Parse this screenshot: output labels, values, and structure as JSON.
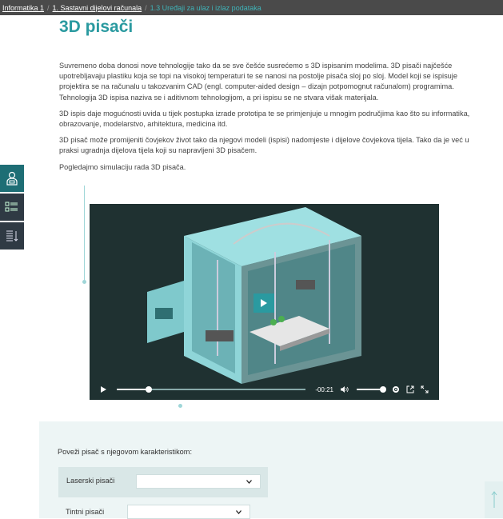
{
  "breadcrumb": {
    "items": [
      "Informatika 1",
      "1. Sastavni dijelovi računala",
      "1.3 Uređaji za ulaz i izlaz podataka"
    ]
  },
  "page": {
    "title": "3D pisači",
    "paragraphs": [
      "Suvremeno doba donosi nove tehnologije tako da se sve češće susrećemo s 3D ispisanim modelima. 3D pisači najčešće upotrebljavaju plastiku koja se topi na visokoj temperaturi te se nanosi na postolje pisača sloj po sloj. Model koji se ispisuje projektira se na računalu u takozvanim CAD (engl. computer-aided design – dizajn potpomognut računalom) programima. Tehnologija 3D ispisa naziva se i aditivnom tehnologijom, a pri ispisu se ne stvara višak materijala.",
      "3D ispis daje mogućnosti uvida u tijek postupka izrade prototipa te se primjenjuje u mnogim područjima kao što su informatika, obrazovanje, modelarstvo, arhitektura, medicina itd.",
      "3D pisač može promijeniti čovjekov život tako da njegovi modeli (ispisi) nadomjeste i dijelove čovjekova tijela. Tako da je već u praksi ugradnja dijelova tijela koji su napravljeni 3D pisačem.",
      "Pogledajmo simulaciju rada 3D pisača."
    ]
  },
  "video": {
    "time_remaining": "-00:21",
    "progress": 0.17,
    "volume": 1.0
  },
  "quiz": {
    "question": "Poveži pisač s njegovom karakteristikom:",
    "rows": [
      {
        "label": "Laserski pisači",
        "value": ""
      },
      {
        "label": "Tintni pisači",
        "value": ""
      }
    ]
  },
  "colors": {
    "accent": "#2a9aa0",
    "topbar": "#4a4a4a",
    "sidetab_teal": "#1e6e75",
    "sidetab_dark": "#2f3a44",
    "quiz_bg": "#edf5f5"
  }
}
